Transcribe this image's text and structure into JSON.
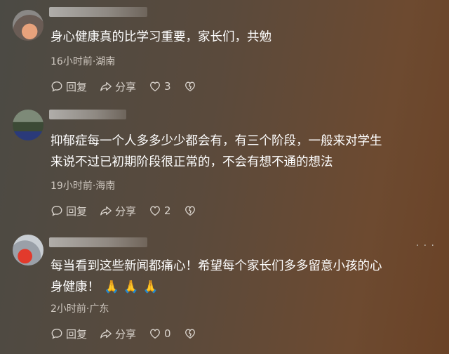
{
  "comments": [
    {
      "text_lines": [
        "身心健康真的比学习重要，家长们，共勉"
      ],
      "meta": "16小时前·湖南",
      "reply": "回复",
      "share": "分享",
      "likes": "3",
      "avatar": "avatar-child-icon"
    },
    {
      "text_lines": [
        "抑郁症每一个人多多少少都会有，有三个阶段，一般来对学生",
        "来说不过已初期阶段很正常的，不会有想不通的想法"
      ],
      "meta": "19小时前·海南",
      "reply": "回复",
      "share": "分享",
      "likes": "2",
      "avatar": "avatar-landscape-icon"
    },
    {
      "text_lines": [
        "每当看到这些新闻都痛心！希望每个家长们多多留意小孩的心",
        "身健康！"
      ],
      "emojis": [
        "🙏",
        "🙏",
        "🙏"
      ],
      "meta": "2小时前·广东",
      "reply": "回复",
      "share": "分享",
      "likes": "0",
      "avatar": "avatar-red-icon"
    }
  ],
  "more_icon": "more-dots-icon"
}
